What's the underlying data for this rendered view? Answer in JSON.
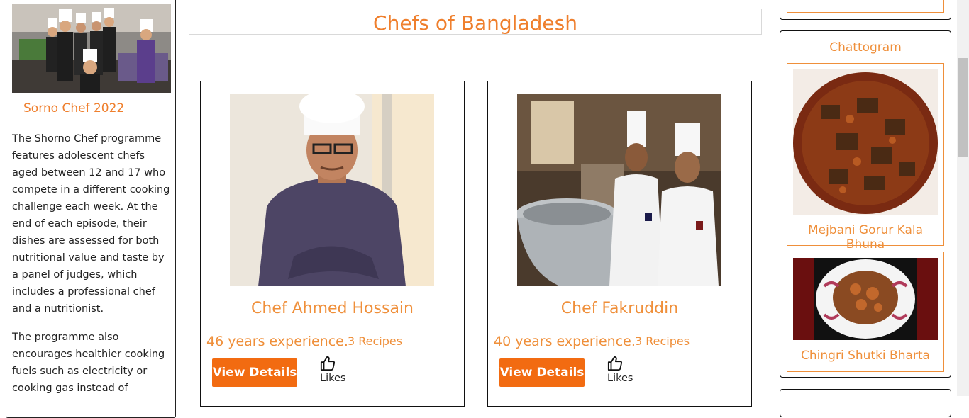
{
  "left": {
    "title": "Sorno Chef 2022",
    "paragraph1": "The Shorno Chef programme features adolescent chefs aged between 12 and 17 who compete in a different cooking challenge each week. At the end of each episode, their dishes are assessed for both nutritional value and taste by a panel of judges, which includes a professional chef and a nutritionist.",
    "paragraph2": "The programme also encourages healthier cooking fuels such as electricity or cooking gas instead of"
  },
  "page": {
    "heading": "Chefs of Bangladesh"
  },
  "chefs": [
    {
      "name": "Chef Ahmed Hossain",
      "experience": "46 years experience.",
      "recipes": "3 Recipes",
      "button": "View Details",
      "likes": "Likes"
    },
    {
      "name": "Chef Fakruddin",
      "experience": "40 years experience.",
      "recipes": "3 Recipes",
      "button": "View Details",
      "likes": "Likes"
    }
  ],
  "right": {
    "region": "Chattogram",
    "dishes": [
      {
        "name": "Mejbani Gorur Kala Bhuna"
      },
      {
        "name": "Chingri Shutki Bharta"
      }
    ]
  },
  "colors": {
    "accent": "#ef7f2d",
    "button": "#f26b11"
  },
  "icons": {
    "like": "thumbs-up-icon"
  }
}
